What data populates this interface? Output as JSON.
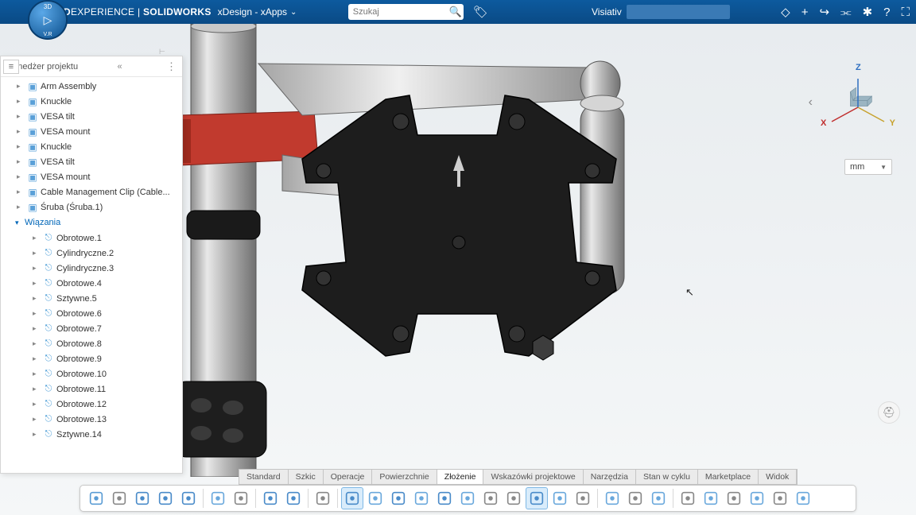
{
  "header": {
    "brand_prefix": "3D",
    "brand_main": "EXPERIENCE",
    "brand_sep": " | ",
    "brand_prod": "SOLIDWORKS",
    "app": "xDesign - xApps",
    "search_placeholder": "Szukaj",
    "user": "Visiativ"
  },
  "compass": {
    "n": "3D",
    "s": "V.R",
    "e": "▸",
    "w": "◂"
  },
  "tree": {
    "title": "Menedżer projektu",
    "parts": [
      "Arm Assembly",
      "Knuckle",
      "VESA tilt",
      "VESA mount",
      "Knuckle",
      "VESA tilt",
      "VESA mount",
      "Cable Management Clip (Cable...",
      "Śruba (Śruba.1)"
    ],
    "section": "Wiązania",
    "mates": [
      "Obrotowe.1",
      "Cylindryczne.2",
      "Cylindryczne.3",
      "Obrotowe.4",
      "Sztywne.5",
      "Obrotowe.6",
      "Obrotowe.7",
      "Obrotowe.8",
      "Obrotowe.9",
      "Obrotowe.10",
      "Obrotowe.11",
      "Obrotowe.12",
      "Obrotowe.13",
      "Sztywne.14"
    ]
  },
  "gizmo": {
    "x": "X",
    "y": "Y",
    "z": "Z"
  },
  "unit": "mm",
  "tabs": [
    "Standard",
    "Szkic",
    "Operacje",
    "Powierzchnie",
    "Złożenie",
    "Wskazówki projektowe",
    "Narzędzia",
    "Stan w cyklu",
    "Marketplace",
    "Widok"
  ],
  "active_tab": 4
}
